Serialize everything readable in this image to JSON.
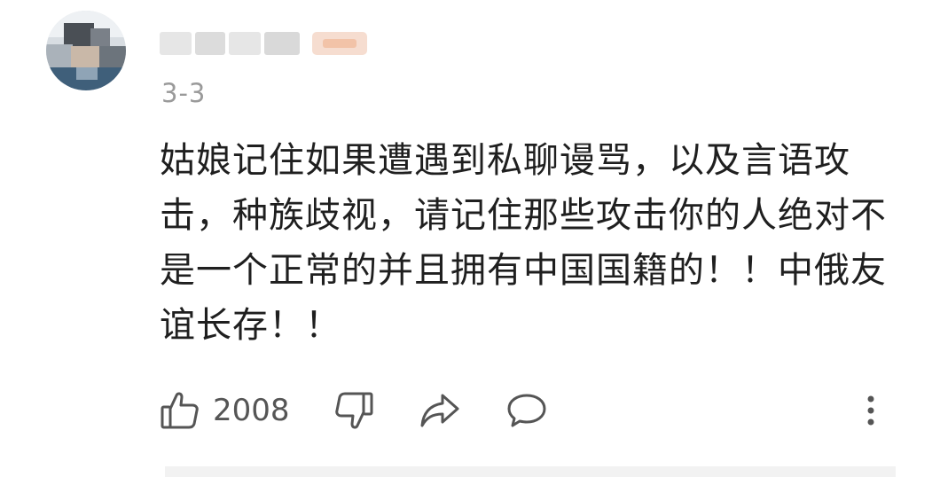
{
  "comment": {
    "username": "",
    "date": "3-3",
    "text": "姑娘记住如果遭遇到私聊谩骂，以及言语攻击，种族歧视，请记住那些攻击你的人绝对不是一个正常的并且拥有中国国籍的！！中俄友谊长存！！",
    "likes": "2008",
    "icons": {
      "like": "thumbs-up-icon",
      "dislike": "thumbs-down-icon",
      "share": "share-icon",
      "reply": "comment-bubble-icon",
      "more": "more-vertical-icon"
    },
    "colors": {
      "text": "#1f1f1f",
      "meta": "#9a9a9a",
      "icon": "#555555",
      "badge": "#f6ddd0"
    }
  }
}
